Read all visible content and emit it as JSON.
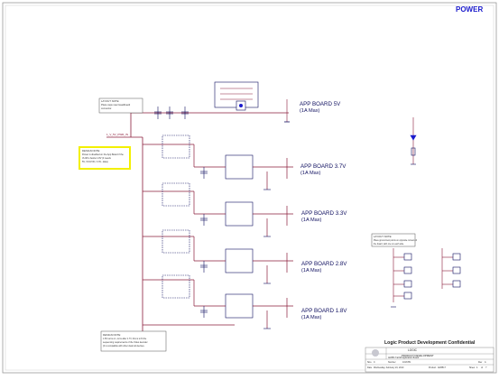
{
  "header": {
    "title": "POWER"
  },
  "rails": [
    {
      "label": "APP BOARD 5V",
      "rating": "(1A Max)"
    },
    {
      "label": "APP BOARD 3.7V",
      "rating": "(1A Max)"
    },
    {
      "label": "APP BOARD 3.3V",
      "rating": "(1A Max)"
    },
    {
      "label": "APP BOARD 2.8V",
      "rating": "(1A Max)"
    },
    {
      "label": "APP BOARD 1.8V",
      "rating": "(1A Max)"
    }
  ],
  "notes": {
    "layout_top": [
      "LAYOUT NOTE:",
      "Place caps near Headboard",
      "connector."
    ],
    "design_top": [
      "DESIGN NOTE:",
      "Power is disabled on the App Board if the",
      "VLIM is below 1.8V (It needs",
      "5V, VCC/VIO, 3.3V...data)"
    ],
    "design_bottom": [
      "DESIGN NOTE:",
      "1.8V turns on ~1ms after 1.7V, this is to fit the",
      "sequencing requirements of the Video decoder",
      "(It is compatible with other dual rail devices."
    ],
    "layout_right": [
      "LAYOUT NOTE:",
      "Place ground test points on opposite corners of",
      "the board, with one on each side."
    ]
  },
  "input_net": "1_V_5V_PWR_IN",
  "company": {
    "confidential": "Logic Product Development Confidential",
    "logo": "LOGIC",
    "dept": "PRODUCT DEVELOPMENT",
    "doc_title": "AM3517 EVM Application Board",
    "size_label": "Size",
    "size": "C",
    "number_label": "Number",
    "number": "1013781",
    "rev_label": "Rev",
    "rev": "A",
    "date_label": "Date",
    "date": "Wednesday, February 24, 2010",
    "product_label": "Product",
    "product": "AM3517",
    "sheet_label": "Sheet",
    "sheet": "4",
    "of_label": "of",
    "of": "?"
  },
  "colors": {
    "wire": "#8a1c3a",
    "part": "#101060",
    "title": "#1a1acc",
    "note_yellow": "#f3f000"
  }
}
